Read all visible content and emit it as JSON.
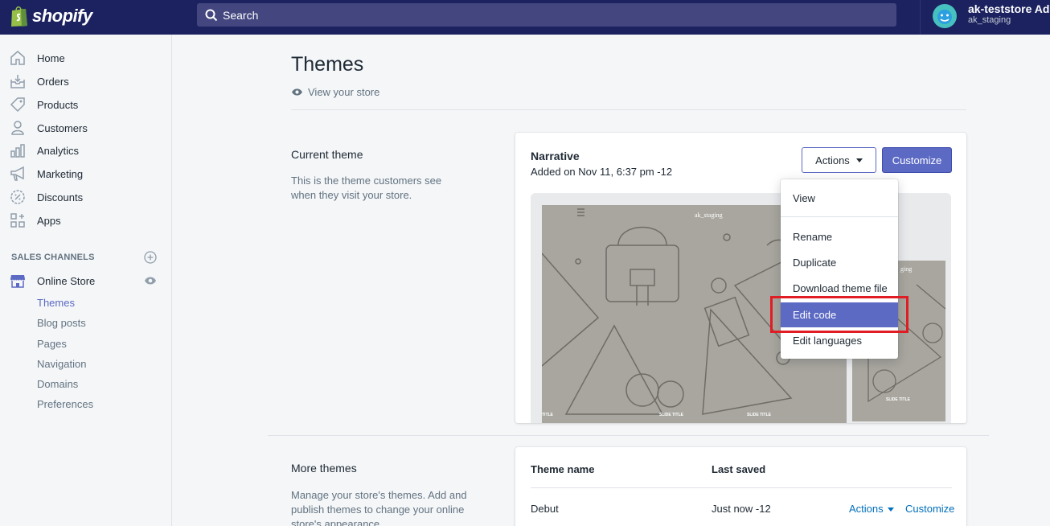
{
  "topbar": {
    "logo_text": "shopify",
    "search_placeholder": "Search",
    "user_name": "ak-teststore Admin",
    "store_name": "ak_staging"
  },
  "sidebar": {
    "items": [
      {
        "label": "Home",
        "icon": "home-icon"
      },
      {
        "label": "Orders",
        "icon": "orders-icon"
      },
      {
        "label": "Products",
        "icon": "tag-icon"
      },
      {
        "label": "Customers",
        "icon": "person-icon"
      },
      {
        "label": "Analytics",
        "icon": "bar-chart-icon"
      },
      {
        "label": "Marketing",
        "icon": "megaphone-icon"
      },
      {
        "label": "Discounts",
        "icon": "discount-icon"
      },
      {
        "label": "Apps",
        "icon": "apps-icon"
      }
    ],
    "sales_channels_title": "SALES CHANNELS",
    "online_store_label": "Online Store",
    "sub_items": [
      "Themes",
      "Blog posts",
      "Pages",
      "Navigation",
      "Domains",
      "Preferences"
    ]
  },
  "main": {
    "title": "Themes",
    "view_store": "View your store",
    "current_theme": {
      "section_title": "Current theme",
      "section_desc": "This is the theme customers see when they visit your store.",
      "theme_name": "Narrative",
      "added": "Added on Nov 11, 6:37 pm -12",
      "actions_label": "Actions",
      "customize_label": "Customize",
      "preview_store_label": "ak_staging",
      "preview_mobile_label": "ging",
      "slide_title": "SLIDE TITLE",
      "slide_title_partial": "TITLE"
    },
    "dropdown": {
      "items": [
        "View",
        "Rename",
        "Duplicate",
        "Download theme file",
        "Edit code",
        "Edit languages"
      ],
      "highlighted": "Edit code"
    },
    "more_themes": {
      "section_title": "More themes",
      "section_desc": "Manage your store's themes. Add and publish themes to change your online store's appearance.",
      "col_name": "Theme name",
      "col_saved": "Last saved",
      "rows": [
        {
          "name": "Debut",
          "saved": "Just now -12",
          "actions": "Actions",
          "customize": "Customize"
        }
      ]
    }
  },
  "colors": {
    "topbar": "#1c2260",
    "accent": "#5c6ac4",
    "highlight_border": "#e01c24",
    "link": "#006fbb"
  }
}
